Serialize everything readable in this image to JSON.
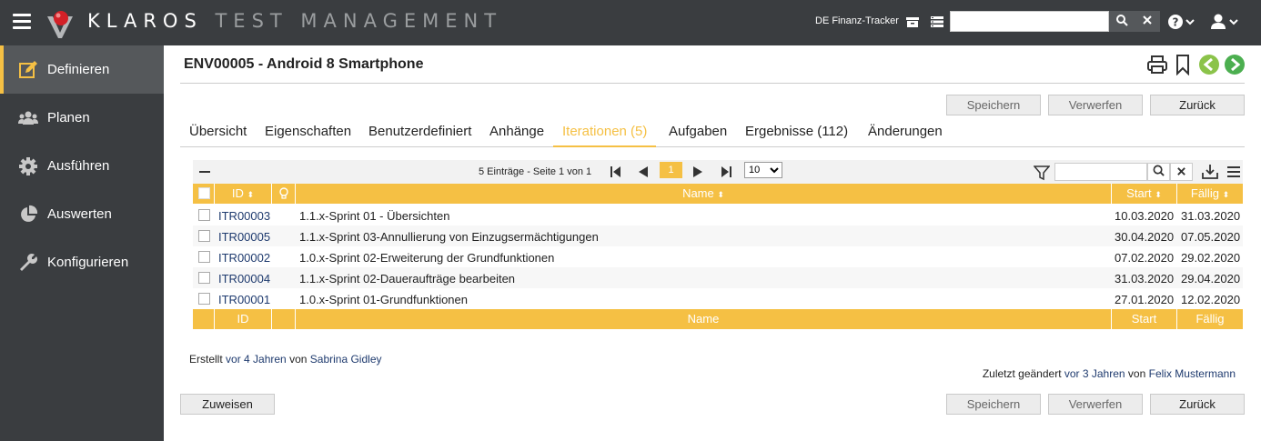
{
  "topbar": {
    "brand_main": "KLAROS",
    "brand_sub": "TEST MANAGEMENT",
    "project": "DE Finanz-Tracker",
    "search_value": "",
    "colors": {
      "bar": "#3a3d40",
      "accent": "#f5c044"
    }
  },
  "sidebar": {
    "items": [
      {
        "label": "Definieren",
        "icon": "edit-icon",
        "active": true
      },
      {
        "label": "Planen",
        "icon": "users-icon",
        "active": false
      },
      {
        "label": "Ausführen",
        "icon": "gear-icon",
        "active": false
      },
      {
        "label": "Auswerten",
        "icon": "pie-chart-icon",
        "active": false
      },
      {
        "label": "Konfigurieren",
        "icon": "wrench-icon",
        "active": false
      }
    ]
  },
  "page": {
    "title": "ENV00005 - Android 8 Smartphone",
    "buttons": {
      "save": "Speichern",
      "discard": "Verwerfen",
      "back": "Zurück",
      "assign": "Zuweisen"
    },
    "tabs": [
      {
        "label": "Übersicht",
        "active": false
      },
      {
        "label": "Eigenschaften",
        "active": false
      },
      {
        "label": "Benutzerdefiniert",
        "active": false
      },
      {
        "label": "Anhänge",
        "active": false
      },
      {
        "label": "Iterationen (5)",
        "active": true
      },
      {
        "label": "Aufgaben",
        "active": false
      },
      {
        "label": "Ergebnisse (112)",
        "active": false
      },
      {
        "label": "Änderungen",
        "active": false
      }
    ]
  },
  "table": {
    "info": "5 Einträge - Seite 1 von 1",
    "current_page": "1",
    "page_size": "10",
    "page_size_options": [
      "10"
    ],
    "filter_value": "",
    "columns": {
      "id": "ID",
      "name": "Name",
      "start": "Start",
      "due": "Fällig"
    },
    "rows": [
      {
        "id": "ITR00003",
        "name": "1.1.x-Sprint 01 - Übersichten",
        "start": "10.03.2020",
        "due": "31.03.2020"
      },
      {
        "id": "ITR00005",
        "name": "1.1.x-Sprint 03-Annullierung von Einzugsermächtigungen",
        "start": "30.04.2020",
        "due": "07.05.2020"
      },
      {
        "id": "ITR00002",
        "name": "1.0.x-Sprint 02-Erweiterung der Grundfunktionen",
        "start": "07.02.2020",
        "due": "29.02.2020"
      },
      {
        "id": "ITR00004",
        "name": "1.1.x-Sprint 02-Daueraufträge bearbeiten",
        "start": "31.03.2020",
        "due": "29.04.2020"
      },
      {
        "id": "ITR00001",
        "name": "1.0.x-Sprint 01-Grundfunktionen",
        "start": "27.01.2020",
        "due": "12.02.2020"
      }
    ]
  },
  "meta": {
    "created_prefix": "Erstellt",
    "created_time": "vor 4 Jahren",
    "created_by_word": "von",
    "created_by": "Sabrina Gidley",
    "changed_prefix": "Zuletzt geändert",
    "changed_time": "vor 3 Jahren",
    "changed_by_word": "von",
    "changed_by": "Felix Mustermann"
  }
}
